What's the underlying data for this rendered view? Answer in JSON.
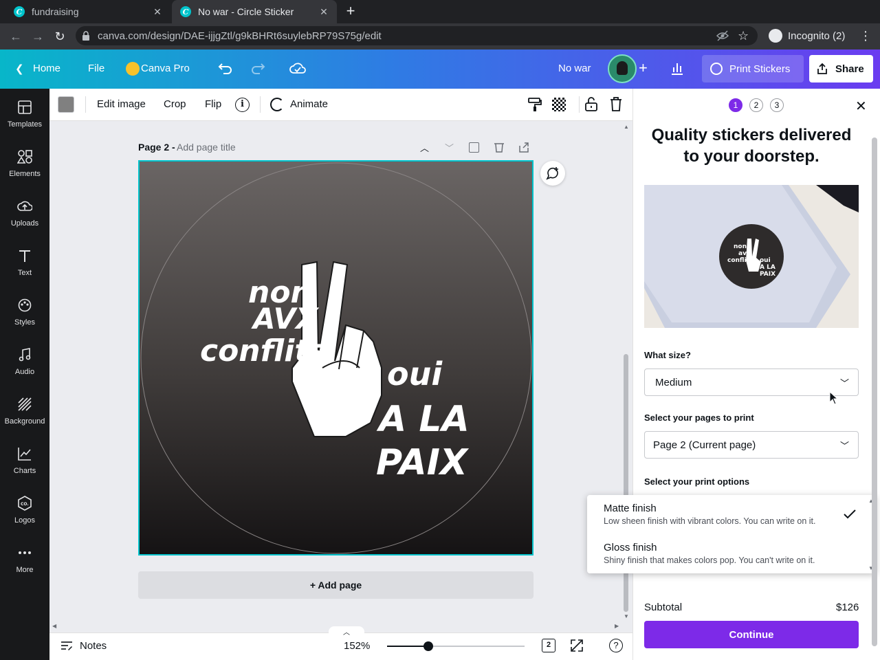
{
  "browser": {
    "tabs": [
      {
        "title": "fundraising",
        "active": false
      },
      {
        "title": "No war - Circle Sticker",
        "active": true
      }
    ],
    "url": "canva.com/design/DAE-ijjgZtl/g9kBHRt6suylebRP79S75g/edit",
    "profile": "Incognito (2)"
  },
  "topbar": {
    "home": "Home",
    "file": "File",
    "canva_pro": "Canva Pro",
    "design_title": "No war",
    "print_stickers": "Print Stickers",
    "share": "Share"
  },
  "rail": [
    {
      "label": "Templates",
      "icon": "templates-icon"
    },
    {
      "label": "Elements",
      "icon": "elements-icon"
    },
    {
      "label": "Uploads",
      "icon": "uploads-icon"
    },
    {
      "label": "Text",
      "icon": "text-icon"
    },
    {
      "label": "Styles",
      "icon": "styles-icon"
    },
    {
      "label": "Audio",
      "icon": "audio-icon"
    },
    {
      "label": "Background",
      "icon": "background-icon"
    },
    {
      "label": "Charts",
      "icon": "charts-icon"
    },
    {
      "label": "Logos",
      "icon": "logos-icon"
    },
    {
      "label": "More",
      "icon": "more-icon"
    }
  ],
  "toolbar": {
    "edit_image": "Edit image",
    "crop": "Crop",
    "flip": "Flip",
    "animate": "Animate",
    "swatch_color": "#808080"
  },
  "canvas": {
    "page_label": "Page 2 -",
    "page_title_placeholder": "Add page title",
    "design_text": {
      "line1": "non",
      "line2": "AVX",
      "line3": "conflits",
      "line4": "oui",
      "line5": "A LA",
      "line6": "PAIX"
    },
    "add_page": "+ Add page"
  },
  "bottombar": {
    "notes": "Notes",
    "zoom": "152%",
    "zoom_fraction": 0.3,
    "page_count": "2"
  },
  "panel": {
    "steps": [
      "1",
      "2",
      "3"
    ],
    "current_step": 1,
    "heading": "Quality stickers delivered to your doorstep.",
    "size_label": "What size?",
    "size_value": "Medium",
    "pages_label": "Select your pages to print",
    "pages_value": "Page 2 (Current page)",
    "print_options_label": "Select your print options",
    "finish_options": [
      {
        "title": "Matte finish",
        "description": "Low sheen finish with vibrant colors. You can write on it.",
        "selected": true
      },
      {
        "title": "Gloss finish",
        "description": "Shiny finish that makes colors pop. You can't write on it.",
        "selected": false
      }
    ],
    "subtotal_label": "Subtotal",
    "subtotal_value": "$126",
    "continue": "Continue",
    "accent": "#7d2ae8"
  }
}
